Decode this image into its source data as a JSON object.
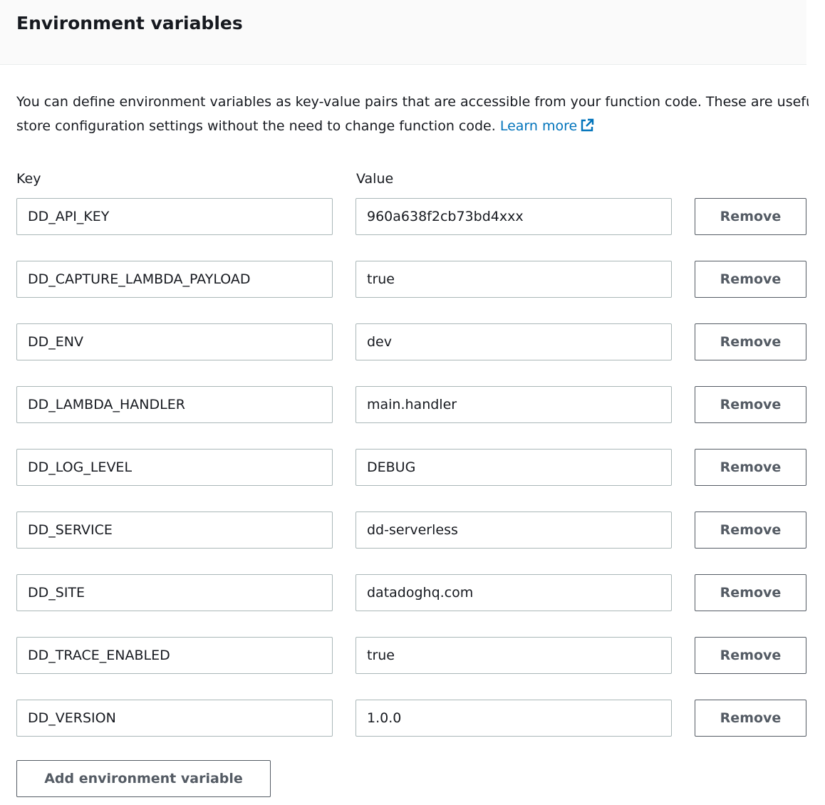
{
  "header": {
    "title": "Environment variables"
  },
  "description": {
    "line1": "You can define environment variables as key-value pairs that are accessible from your function code. These are useful to",
    "line2": "store configuration settings without the need to change function code.",
    "learn_more": "Learn more",
    "learn_more_icon": "external-link-icon"
  },
  "columns": {
    "key_label": "Key",
    "value_label": "Value"
  },
  "variables": [
    {
      "key": "DD_API_KEY",
      "value": "960a638f2cb73bd4xxx",
      "remove_label": "Remove"
    },
    {
      "key": "DD_CAPTURE_LAMBDA_PAYLOAD",
      "value": "true",
      "remove_label": "Remove"
    },
    {
      "key": "DD_ENV",
      "value": "dev",
      "remove_label": "Remove"
    },
    {
      "key": "DD_LAMBDA_HANDLER",
      "value": "main.handler",
      "remove_label": "Remove"
    },
    {
      "key": "DD_LOG_LEVEL",
      "value": "DEBUG",
      "remove_label": "Remove"
    },
    {
      "key": "DD_SERVICE",
      "value": "dd-serverless",
      "remove_label": "Remove"
    },
    {
      "key": "DD_SITE",
      "value": "datadoghq.com",
      "remove_label": "Remove"
    },
    {
      "key": "DD_TRACE_ENABLED",
      "value": "true",
      "remove_label": "Remove"
    },
    {
      "key": "DD_VERSION",
      "value": "1.0.0",
      "remove_label": "Remove"
    }
  ],
  "actions": {
    "add_label": "Add environment variable"
  },
  "colors": {
    "link": "#0073bb",
    "text": "#16191f",
    "border": "#aab7b8",
    "button_text": "#545b64",
    "header_bg": "#fafafa"
  }
}
